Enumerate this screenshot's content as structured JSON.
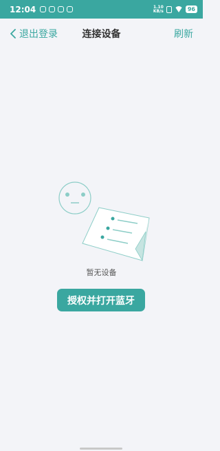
{
  "status_bar": {
    "time": "12:04",
    "network_speed_top": "1.10",
    "network_speed_bottom": "KB/s",
    "battery": "96"
  },
  "nav": {
    "back_label": "退出登录",
    "title": "连接设备",
    "refresh_label": "刷新"
  },
  "empty_state": {
    "message": "暂无设备",
    "button_label": "授权并打开蓝牙"
  },
  "colors": {
    "accent": "#3aa7a0",
    "background": "#f3f4f8"
  },
  "icons": {
    "back": "chevron-left-icon",
    "illustration": "empty-face-and-paper"
  }
}
